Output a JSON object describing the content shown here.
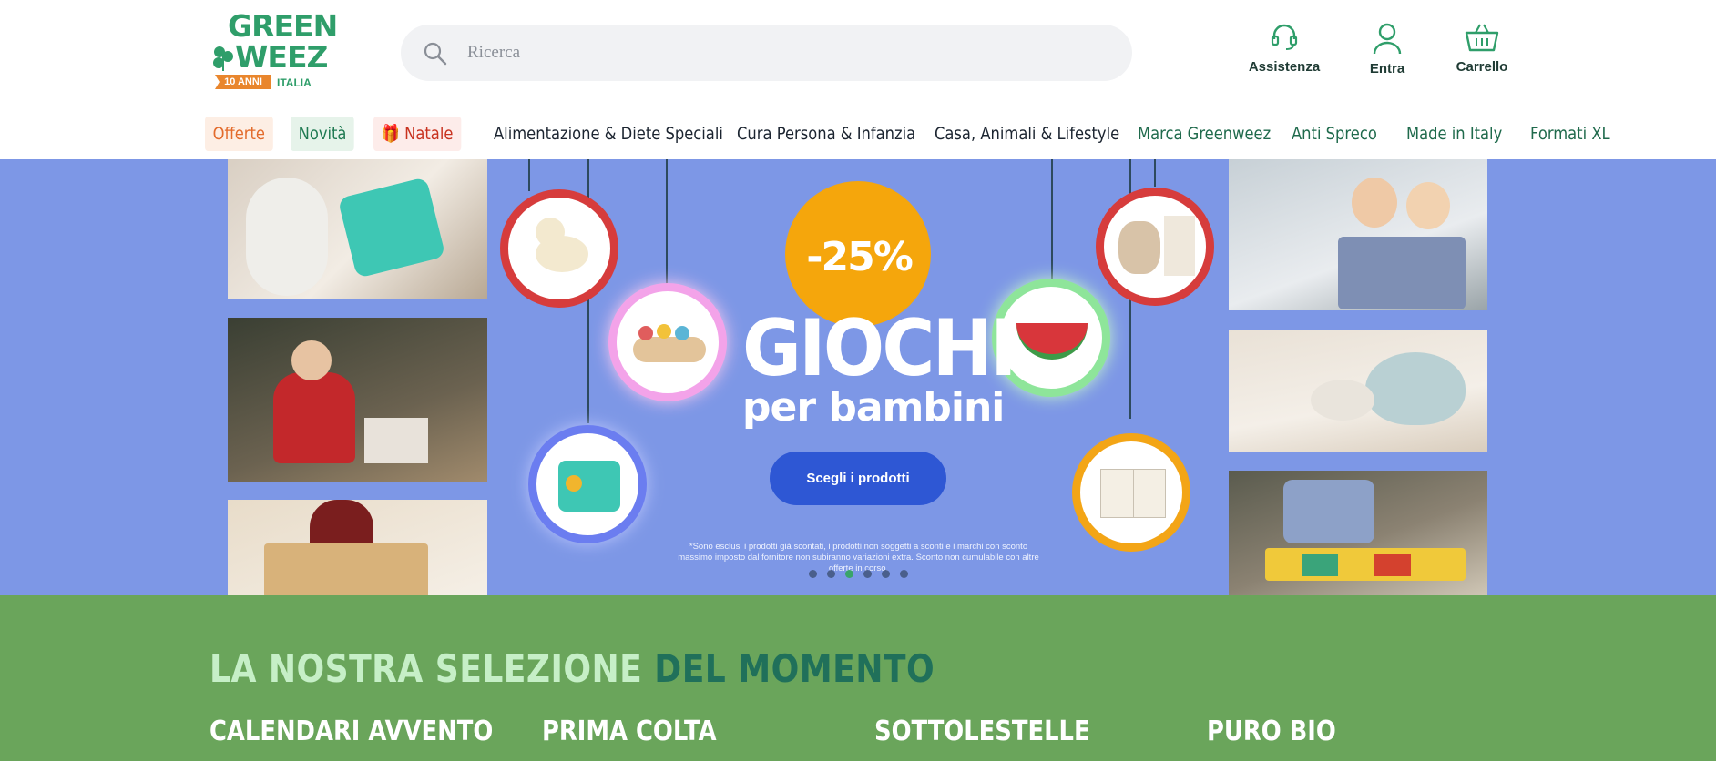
{
  "header": {
    "logo": {
      "line1": "GREEN",
      "line2": "WEEZ",
      "ribbon": "10 ANNI",
      "country": "ITALIA"
    },
    "search": {
      "placeholder": "Ricerca",
      "icon": "search-icon"
    },
    "actions": [
      {
        "label": "Assistenza",
        "icon": "headset-icon"
      },
      {
        "label": "Entra",
        "icon": "user-icon"
      },
      {
        "label": "Carrello",
        "icon": "basket-icon"
      }
    ]
  },
  "nav": {
    "items": [
      {
        "label": "Offerte",
        "style": "chip-orange"
      },
      {
        "label": "Novità",
        "style": "chip-green"
      },
      {
        "label": "Natale",
        "style": "chip-red",
        "icon": "gift-icon"
      },
      {
        "label": "Alimentazione & Diete Speciali"
      },
      {
        "label": "Cura Persona & Infanzia"
      },
      {
        "label": "Casa, Animali & Lifestyle"
      },
      {
        "label": "Marca Greenweez"
      },
      {
        "label": "Anti Spreco"
      },
      {
        "label": "Made in Italy"
      },
      {
        "label": "Formati XL"
      }
    ]
  },
  "hero": {
    "discount": "-25%",
    "headline": "GIOCHI",
    "subheadline": "per bambini",
    "cta": "Scegli i prodotti",
    "disclaimer": "*Sono esclusi i prodotti già scontati, i prodotti non soggetti a sconti e i marchi con sconto massimo imposto dal fornitore non subiranno variazioni extra.  Sconto non cumulabile con altre offerte in corso.",
    "carousel": {
      "slides": 6,
      "active_index": 2
    },
    "background": "#7d97e6"
  },
  "selection": {
    "title_part1": "LA NOSTRA SELEZIONE",
    "title_part2": "DEL MOMENTO",
    "categories": [
      "CALENDARI AVVENTO",
      "PRIMA COLTA",
      "SOTTOLESTELLE",
      "PURO BIO"
    ]
  },
  "colors": {
    "brand_green": "#2f9e6a",
    "offer_orange": "#e36b2c",
    "natale_red": "#c8321f",
    "selection_bg": "#6aa55b",
    "cta_blue": "#2e57d4"
  }
}
